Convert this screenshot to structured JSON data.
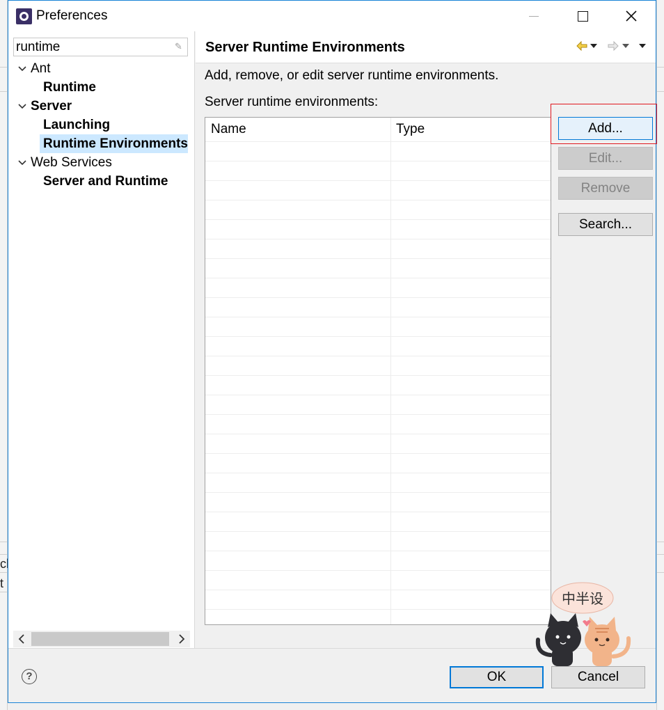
{
  "window": {
    "title": "Preferences"
  },
  "left_pane": {
    "filter_value": "runtime",
    "tree": [
      {
        "label": "Ant",
        "level": 0,
        "bold": false,
        "expanded": true
      },
      {
        "label": "Runtime",
        "level": 1,
        "bold": true
      },
      {
        "label": "Server",
        "level": 0,
        "bold": true,
        "expanded": true
      },
      {
        "label": "Launching",
        "level": 1,
        "bold": true
      },
      {
        "label": "Runtime Environments",
        "level": 1,
        "bold": true,
        "selected": true
      },
      {
        "label": "Web Services",
        "level": 0,
        "bold": false,
        "expanded": true
      },
      {
        "label": "Server and Runtime",
        "level": 1,
        "bold": true
      }
    ]
  },
  "page": {
    "title": "Server Runtime Environments",
    "description": "Add, remove, or edit server runtime environments.",
    "list_label": "Server runtime environments:",
    "columns": [
      "Name",
      "Type"
    ],
    "rows": []
  },
  "buttons": {
    "add": "Add...",
    "edit": "Edit...",
    "remove": "Remove",
    "search": "Search..."
  },
  "dialog": {
    "ok": "OK",
    "cancel": "Cancel",
    "help": "?"
  },
  "watermark": {
    "text": "中半设"
  },
  "background_fragments": [
    "cl",
    "t"
  ],
  "colors": {
    "selection": "#cce8ff",
    "accent": "#0078d7",
    "highlight_box": "#e0161d"
  }
}
